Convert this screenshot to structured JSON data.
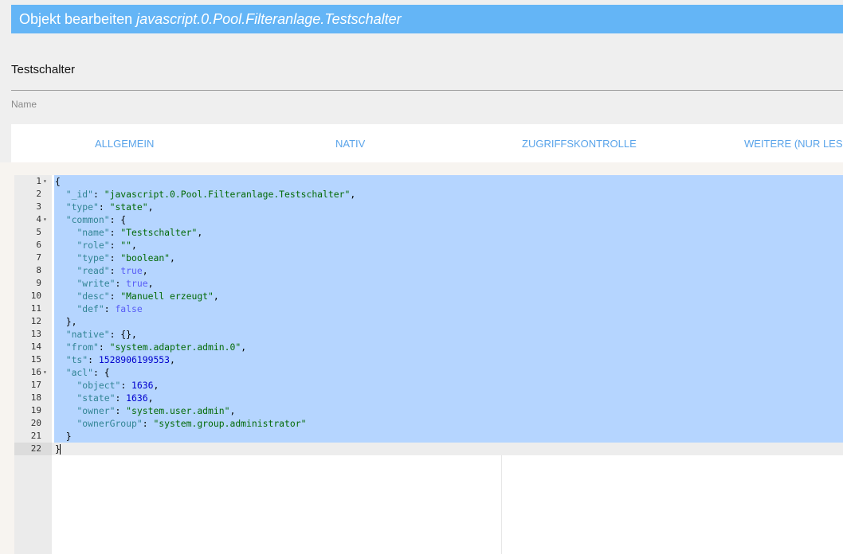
{
  "dialog": {
    "title_prefix": "Objekt bearbeiten",
    "title_object": "javascript.0.Pool.Filteranlage.Testschalter"
  },
  "name_field": {
    "value": "Testschalter",
    "label": "Name"
  },
  "tabs": [
    {
      "label": "ALLGEMEIN"
    },
    {
      "label": "NATIV"
    },
    {
      "label": "ZUGRIFFSKONTROLLE"
    },
    {
      "label": "WEITERE (NUR LESEN)"
    }
  ],
  "editor": {
    "lines": [
      {
        "no": "1",
        "fold": true,
        "tokens": [
          [
            "p",
            "{"
          ]
        ]
      },
      {
        "no": "2",
        "fold": false,
        "tokens": [
          [
            "p",
            "  "
          ],
          [
            "k",
            "\"_id\""
          ],
          [
            "p",
            ": "
          ],
          [
            "s",
            "\"javascript.0.Pool.Filteranlage.Testschalter\""
          ],
          [
            "p",
            ","
          ]
        ]
      },
      {
        "no": "3",
        "fold": false,
        "tokens": [
          [
            "p",
            "  "
          ],
          [
            "k",
            "\"type\""
          ],
          [
            "p",
            ": "
          ],
          [
            "s",
            "\"state\""
          ],
          [
            "p",
            ","
          ]
        ]
      },
      {
        "no": "4",
        "fold": true,
        "tokens": [
          [
            "p",
            "  "
          ],
          [
            "k",
            "\"common\""
          ],
          [
            "p",
            ": {"
          ]
        ]
      },
      {
        "no": "5",
        "fold": false,
        "tokens": [
          [
            "p",
            "    "
          ],
          [
            "k",
            "\"name\""
          ],
          [
            "p",
            ": "
          ],
          [
            "s",
            "\"Testschalter\""
          ],
          [
            "p",
            ","
          ]
        ]
      },
      {
        "no": "6",
        "fold": false,
        "tokens": [
          [
            "p",
            "    "
          ],
          [
            "k",
            "\"role\""
          ],
          [
            "p",
            ": "
          ],
          [
            "s",
            "\"\""
          ],
          [
            "p",
            ","
          ]
        ]
      },
      {
        "no": "7",
        "fold": false,
        "tokens": [
          [
            "p",
            "    "
          ],
          [
            "k",
            "\"type\""
          ],
          [
            "p",
            ": "
          ],
          [
            "s",
            "\"boolean\""
          ],
          [
            "p",
            ","
          ]
        ]
      },
      {
        "no": "8",
        "fold": false,
        "tokens": [
          [
            "p",
            "    "
          ],
          [
            "k",
            "\"read\""
          ],
          [
            "p",
            ": "
          ],
          [
            "b",
            "true"
          ],
          [
            "p",
            ","
          ]
        ]
      },
      {
        "no": "9",
        "fold": false,
        "tokens": [
          [
            "p",
            "    "
          ],
          [
            "k",
            "\"write\""
          ],
          [
            "p",
            ": "
          ],
          [
            "b",
            "true"
          ],
          [
            "p",
            ","
          ]
        ]
      },
      {
        "no": "10",
        "fold": false,
        "tokens": [
          [
            "p",
            "    "
          ],
          [
            "k",
            "\"desc\""
          ],
          [
            "p",
            ": "
          ],
          [
            "s",
            "\"Manuell erzeugt\""
          ],
          [
            "p",
            ","
          ]
        ]
      },
      {
        "no": "11",
        "fold": false,
        "tokens": [
          [
            "p",
            "    "
          ],
          [
            "k",
            "\"def\""
          ],
          [
            "p",
            ": "
          ],
          [
            "b",
            "false"
          ]
        ]
      },
      {
        "no": "12",
        "fold": false,
        "tokens": [
          [
            "p",
            "  },"
          ]
        ]
      },
      {
        "no": "13",
        "fold": false,
        "tokens": [
          [
            "p",
            "  "
          ],
          [
            "k",
            "\"native\""
          ],
          [
            "p",
            ": {},"
          ]
        ]
      },
      {
        "no": "14",
        "fold": false,
        "tokens": [
          [
            "p",
            "  "
          ],
          [
            "k",
            "\"from\""
          ],
          [
            "p",
            ": "
          ],
          [
            "s",
            "\"system.adapter.admin.0\""
          ],
          [
            "p",
            ","
          ]
        ]
      },
      {
        "no": "15",
        "fold": false,
        "tokens": [
          [
            "p",
            "  "
          ],
          [
            "k",
            "\"ts\""
          ],
          [
            "p",
            ": "
          ],
          [
            "n",
            "1528906199553"
          ],
          [
            "p",
            ","
          ]
        ]
      },
      {
        "no": "16",
        "fold": true,
        "tokens": [
          [
            "p",
            "  "
          ],
          [
            "k",
            "\"acl\""
          ],
          [
            "p",
            ": {"
          ]
        ]
      },
      {
        "no": "17",
        "fold": false,
        "tokens": [
          [
            "p",
            "    "
          ],
          [
            "k",
            "\"object\""
          ],
          [
            "p",
            ": "
          ],
          [
            "n",
            "1636"
          ],
          [
            "p",
            ","
          ]
        ]
      },
      {
        "no": "18",
        "fold": false,
        "tokens": [
          [
            "p",
            "    "
          ],
          [
            "k",
            "\"state\""
          ],
          [
            "p",
            ": "
          ],
          [
            "n",
            "1636"
          ],
          [
            "p",
            ","
          ]
        ]
      },
      {
        "no": "19",
        "fold": false,
        "tokens": [
          [
            "p",
            "    "
          ],
          [
            "k",
            "\"owner\""
          ],
          [
            "p",
            ": "
          ],
          [
            "s",
            "\"system.user.admin\""
          ],
          [
            "p",
            ","
          ]
        ]
      },
      {
        "no": "20",
        "fold": false,
        "tokens": [
          [
            "p",
            "    "
          ],
          [
            "k",
            "\"ownerGroup\""
          ],
          [
            "p",
            ": "
          ],
          [
            "s",
            "\"system.group.administrator\""
          ]
        ]
      },
      {
        "no": "21",
        "fold": false,
        "tokens": [
          [
            "p",
            "  }"
          ]
        ]
      },
      {
        "no": "22",
        "fold": false,
        "tokens": [
          [
            "p",
            "}"
          ]
        ]
      }
    ],
    "fold_icon": "caret-down-icon",
    "colors": {
      "selection": "#b5d5ff",
      "key": "#318495",
      "string": "#036a07",
      "number": "#0000cd",
      "boolean": "#585cf6"
    }
  },
  "colors": {
    "title_bar": "#64b5f6",
    "tab_text": "#5aa4ea"
  }
}
